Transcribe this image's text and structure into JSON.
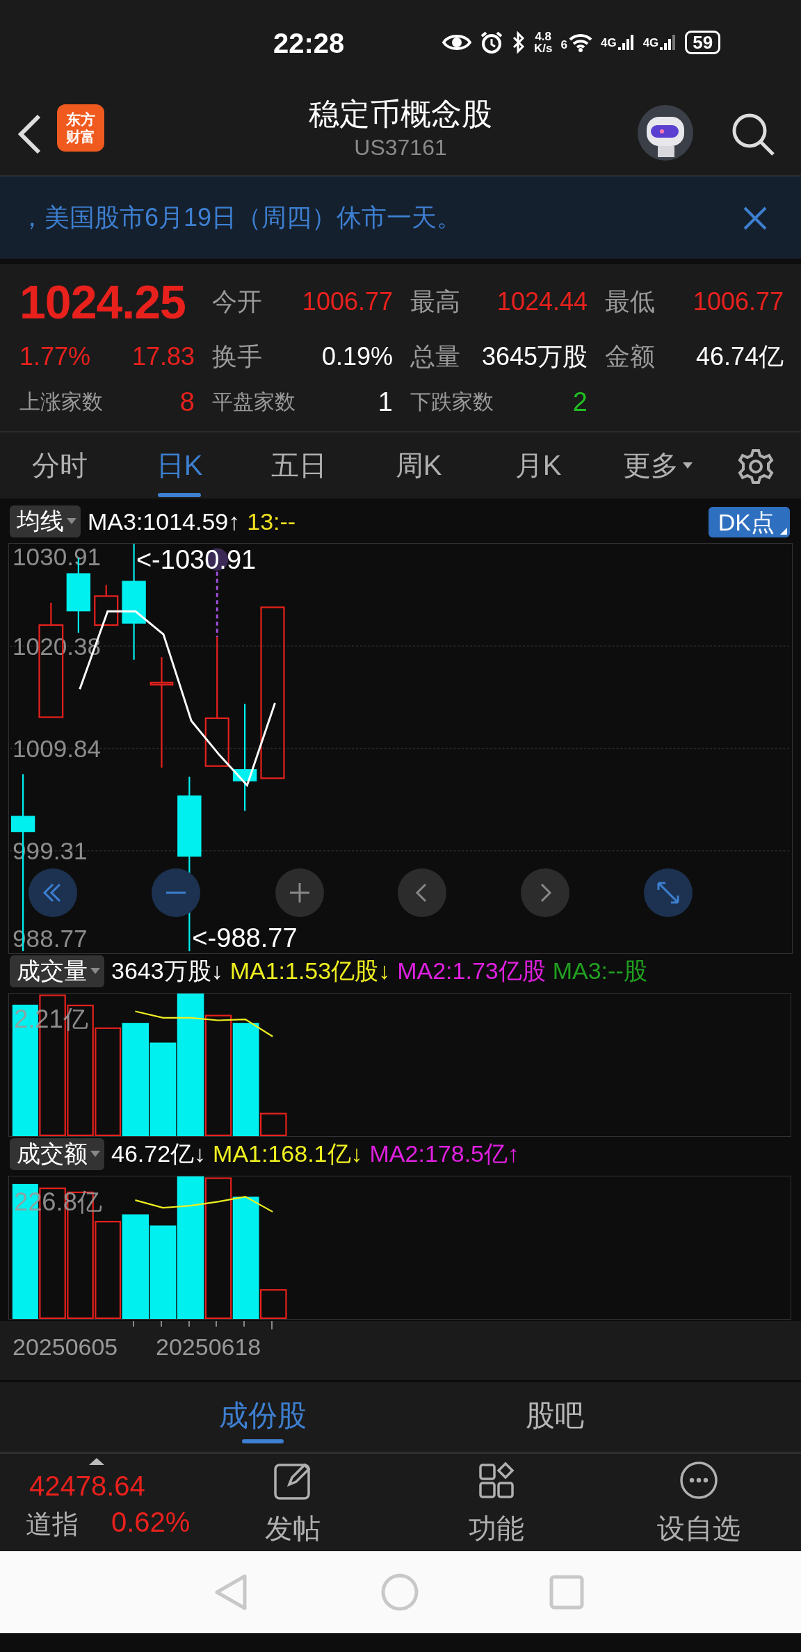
{
  "status_bar": {
    "time": "22:28",
    "speed_value": "4.8",
    "speed_unit": "K/s",
    "wifi_label": "6",
    "sim_labels": [
      "4G",
      "4G"
    ],
    "battery": "59"
  },
  "header": {
    "logo_lines": [
      "东方",
      "财富"
    ],
    "title": "稳定币概念股",
    "code": "US37161"
  },
  "banner": {
    "text": "，美国股市6月19日（周四）休市一天。"
  },
  "quote": {
    "price": "1024.25",
    "change_pct": "1.77%",
    "change": "17.83",
    "stats": [
      {
        "label": "今开",
        "value": "1006.77",
        "color": "#e8211d"
      },
      {
        "label": "最高",
        "value": "1024.44",
        "color": "#e8211d"
      },
      {
        "label": "最低",
        "value": "1006.77",
        "color": "#e8211d"
      },
      {
        "label": "换手",
        "value": "0.19%",
        "color": "#ffffff"
      },
      {
        "label": "总量",
        "value": "3645万股",
        "color": "#ffffff"
      },
      {
        "label": "金额",
        "value": "46.74亿",
        "color": "#ffffff"
      }
    ],
    "breadth": [
      {
        "label": "上涨家数",
        "value": "8",
        "color": "#e8211d"
      },
      {
        "label": "平盘家数",
        "value": "1",
        "color": "#ffffff"
      },
      {
        "label": "下跌家数",
        "value": "2",
        "color": "#22c022"
      }
    ]
  },
  "period_tabs": [
    {
      "label": "分时",
      "selected": false,
      "kind": "tab"
    },
    {
      "label": "日K",
      "selected": true,
      "kind": "tab"
    },
    {
      "label": "五日",
      "selected": false,
      "kind": "tab"
    },
    {
      "label": "周K",
      "selected": false,
      "kind": "tab"
    },
    {
      "label": "月K",
      "selected": false,
      "kind": "tab"
    },
    {
      "label": "更多",
      "selected": false,
      "kind": "dropdown"
    }
  ],
  "kline": {
    "indicator": "均线",
    "readouts": [
      {
        "kind": "series_value",
        "text": ":1014.59↑",
        "color": "#ffffff"
      },
      {
        "text": "13:--",
        "color": "#f0e020"
      }
    ],
    "dk_button": "DK点",
    "chart_data": {
      "type": "line",
      "grid": true,
      "ylim": [
        988.77,
        1030.91
      ],
      "yticks": [
        {
          "value": 1030.91,
          "label": "1030.91"
        },
        {
          "value": 1020.38,
          "label": "1020.38"
        },
        {
          "value": 1009.84,
          "label": "1009.84"
        },
        {
          "value": 999.31,
          "label": "999.31"
        },
        {
          "value": 988.77,
          "label": "988.77"
        }
      ],
      "series": [
        {
          "name": "MA3",
          "color": "#ffffff",
          "values": [
            null,
            null,
            1015.94,
            1023.95,
            1023.95,
            1021.59,
            1012.69,
            1009.19,
            1006.05,
            1014.52,
            null,
            null,
            null,
            null,
            null,
            null,
            null,
            null,
            null,
            null,
            null,
            null,
            null,
            null,
            null,
            null,
            null,
            null
          ]
        }
      ]
    },
    "high_marker": "<-1030.91",
    "low_marker": "<-988.77"
  },
  "volume": {
    "indicator": "成交量",
    "readouts": [
      {
        "text": "3643万股↓",
        "color": "#ffffff"
      },
      {
        "text": "MA1:1.53亿股↓",
        "color": "#f0f020"
      },
      {
        "text": "MA2:1.73亿股",
        "color": "#e020e0"
      },
      {
        "text": "MA3:--股",
        "color": "#20a020"
      }
    ],
    "max_label": "2.21亿"
  },
  "amount": {
    "indicator": "成交额",
    "readouts": [
      {
        "text": "46.72亿↓",
        "color": "#ffffff"
      },
      {
        "text": "MA1:168.1亿↓",
        "color": "#f0f020"
      },
      {
        "text": "MA2:178.5亿↑",
        "color": "#e020e0"
      }
    ],
    "max_label": "226.8亿"
  },
  "date_axis": [
    "20250605",
    "20250618"
  ],
  "bottom_tabs": [
    {
      "label": "成份股",
      "selected": true
    },
    {
      "label": "股吧",
      "selected": false
    }
  ],
  "toolbar": {
    "index": {
      "value": "42478.64",
      "name": "道指",
      "change": "0.62%"
    },
    "actions": [
      {
        "label": "发帖",
        "kind": "post"
      },
      {
        "label": "功能",
        "kind": "apps"
      },
      {
        "label": "设自选",
        "kind": "more"
      }
    ]
  }
}
